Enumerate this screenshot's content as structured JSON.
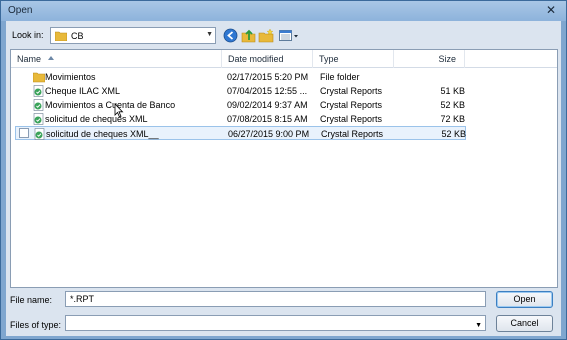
{
  "window": {
    "title": "Open"
  },
  "toolbar": {
    "look_in_label": "Look in:",
    "look_in_value": "CB"
  },
  "columns": {
    "name": "Name",
    "date": "Date modified",
    "type": "Type",
    "size": "Size"
  },
  "files": [
    {
      "name": "Movimientos",
      "date": "02/17/2015 5:20 PM",
      "type": "File folder",
      "size": "",
      "icon": "folder-icon"
    },
    {
      "name": "Cheque ILAC XML",
      "date": "07/04/2015 12:55 ...",
      "type": "Crystal Reports",
      "size": "51 KB",
      "icon": "crystal-report-icon"
    },
    {
      "name": "Movimientos a Cuenta de Banco",
      "date": "09/02/2014 9:37 AM",
      "type": "Crystal Reports",
      "size": "52 KB",
      "icon": "crystal-report-icon"
    },
    {
      "name": "solicitud de cheques XML",
      "date": "07/08/2015 8:15 AM",
      "type": "Crystal Reports",
      "size": "72 KB",
      "icon": "crystal-report-icon"
    },
    {
      "name": "solicitud de cheques XML__",
      "date": "06/27/2015 9:00 PM",
      "type": "Crystal Reports",
      "size": "52 KB",
      "icon": "crystal-report-icon"
    }
  ],
  "bottom": {
    "file_name_label": "File name:",
    "file_name_value": "*.RPT",
    "files_of_type_label": "Files of type:",
    "files_of_type_value": "",
    "open_label": "Open",
    "cancel_label": "Cancel"
  },
  "colors": {
    "folder": "#e8b93a",
    "report": "#3aa35a",
    "selection": "#e9f2fc"
  }
}
